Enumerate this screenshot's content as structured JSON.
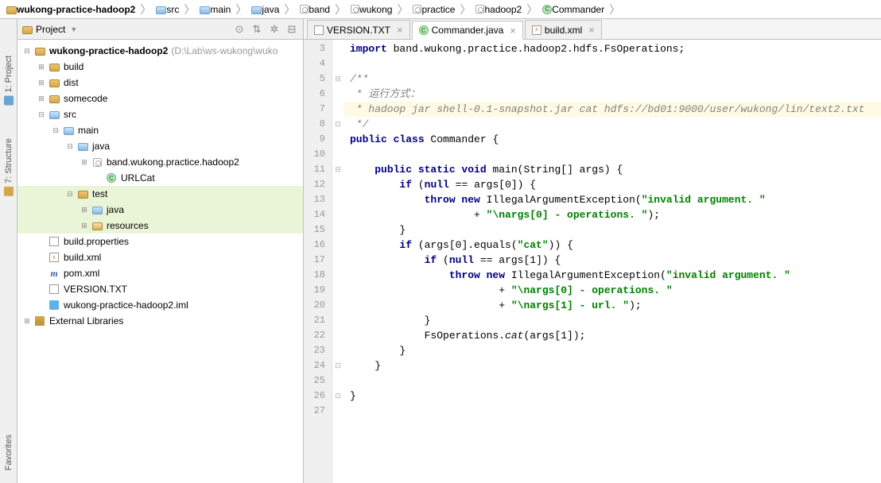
{
  "breadcrumb": [
    {
      "icon": "folder",
      "label": "wukong-practice-hadoop2"
    },
    {
      "icon": "src",
      "label": "src"
    },
    {
      "icon": "src",
      "label": "main"
    },
    {
      "icon": "src",
      "label": "java"
    },
    {
      "icon": "pkg",
      "label": "band"
    },
    {
      "icon": "pkg",
      "label": "wukong"
    },
    {
      "icon": "pkg",
      "label": "practice"
    },
    {
      "icon": "pkg",
      "label": "hadoop2"
    },
    {
      "icon": "class",
      "label": "Commander"
    }
  ],
  "rail": {
    "project": "1: Project",
    "structure": "7: Structure",
    "favorites": "Favorites"
  },
  "panel": {
    "title": "Project",
    "tools": [
      "⊙",
      "⇅",
      "✲",
      "⊟"
    ]
  },
  "tree": [
    {
      "d": 0,
      "t": "−",
      "i": "folder",
      "l": "wukong-practice-hadoop2",
      "bold": true,
      "hint": "(D:\\Lab\\ws-wukong\\wuko"
    },
    {
      "d": 1,
      "t": "+",
      "i": "folder",
      "l": "build"
    },
    {
      "d": 1,
      "t": "+",
      "i": "folder",
      "l": "dist"
    },
    {
      "d": 1,
      "t": "+",
      "i": "folder",
      "l": "somecode"
    },
    {
      "d": 1,
      "t": "−",
      "i": "src",
      "l": "src"
    },
    {
      "d": 2,
      "t": "−",
      "i": "src",
      "l": "main"
    },
    {
      "d": 3,
      "t": "−",
      "i": "src",
      "l": "java"
    },
    {
      "d": 4,
      "t": "+",
      "i": "pkg",
      "l": "band.wukong.practice.hadoop2"
    },
    {
      "d": 5,
      "t": "",
      "i": "class",
      "l": "URLCat"
    },
    {
      "d": 3,
      "t": "−",
      "i": "folder",
      "l": "test",
      "sel": true
    },
    {
      "d": 4,
      "t": "+",
      "i": "src",
      "l": "java",
      "sel": true
    },
    {
      "d": 4,
      "t": "+",
      "i": "res",
      "l": "resources",
      "sel": true
    },
    {
      "d": 1,
      "t": "",
      "i": "prop",
      "l": "build.properties"
    },
    {
      "d": 1,
      "t": "",
      "i": "xml",
      "l": "build.xml"
    },
    {
      "d": 1,
      "t": "",
      "i": "maven",
      "l": "pom.xml"
    },
    {
      "d": 1,
      "t": "",
      "i": "txt",
      "l": "VERSION.TXT"
    },
    {
      "d": 1,
      "t": "",
      "i": "iml",
      "l": "wukong-practice-hadoop2.iml"
    },
    {
      "d": 0,
      "t": "+",
      "i": "lib",
      "l": "External Libraries"
    }
  ],
  "tabs": [
    {
      "icon": "txt",
      "label": "VERSION.TXT",
      "active": false
    },
    {
      "icon": "class",
      "label": "Commander.java",
      "active": true
    },
    {
      "icon": "xml",
      "label": "build.xml",
      "active": false
    }
  ],
  "code": {
    "start": 3,
    "lines": [
      {
        "fold": "",
        "html": "<span class='kw'>import</span> band.wukong.practice.hadoop2.hdfs.FsOperations;"
      },
      {
        "fold": "",
        "html": ""
      },
      {
        "fold": "⊟",
        "html": "<span class='com'>/**</span>"
      },
      {
        "fold": "",
        "html": "<span class='com'> * 运行方式：</span>"
      },
      {
        "fold": "",
        "hl": true,
        "html": "<span class='com'> * hadoop jar shell-0.1-snapshot.jar cat hdfs://bd01:9000/user/wukong/lin/text2.txt</span>"
      },
      {
        "fold": "⊡",
        "html": "<span class='com'> */</span>"
      },
      {
        "fold": "",
        "html": "<span class='kw'>public class</span> Commander {"
      },
      {
        "fold": "",
        "html": ""
      },
      {
        "fold": "⊟",
        "html": "    <span class='kw'>public static void</span> main(String[] args) {"
      },
      {
        "fold": "",
        "html": "        <span class='kw'>if</span> (<span class='kw'>null</span> == args[0]) {"
      },
      {
        "fold": "",
        "html": "            <span class='kw'>throw new</span> IllegalArgumentException(<span class='str'>\"invalid argument. \"</span>"
      },
      {
        "fold": "",
        "html": "                    + <span class='str'>\"\\nargs[0] - operations. \"</span>);"
      },
      {
        "fold": "",
        "html": "        }"
      },
      {
        "fold": "",
        "html": "        <span class='kw'>if</span> (args[0].equals(<span class='str'>\"cat\"</span>)) {"
      },
      {
        "fold": "",
        "html": "            <span class='kw'>if</span> (<span class='kw'>null</span> == args[1]) {"
      },
      {
        "fold": "",
        "html": "                <span class='kw'>throw new</span> IllegalArgumentException(<span class='str'>\"invalid argument. \"</span>"
      },
      {
        "fold": "",
        "html": "                        + <span class='str'>\"\\nargs[0] - operations. \"</span>"
      },
      {
        "fold": "",
        "html": "                        + <span class='str'>\"\\nargs[1] - url. \"</span>);"
      },
      {
        "fold": "",
        "html": "            }"
      },
      {
        "fold": "",
        "html": "            FsOperations.<span class='it'>cat</span>(args[1]);"
      },
      {
        "fold": "",
        "html": "        }"
      },
      {
        "fold": "⊡",
        "html": "    }"
      },
      {
        "fold": "",
        "html": ""
      },
      {
        "fold": "⊡",
        "html": "}"
      },
      {
        "fold": "",
        "html": ""
      }
    ]
  }
}
